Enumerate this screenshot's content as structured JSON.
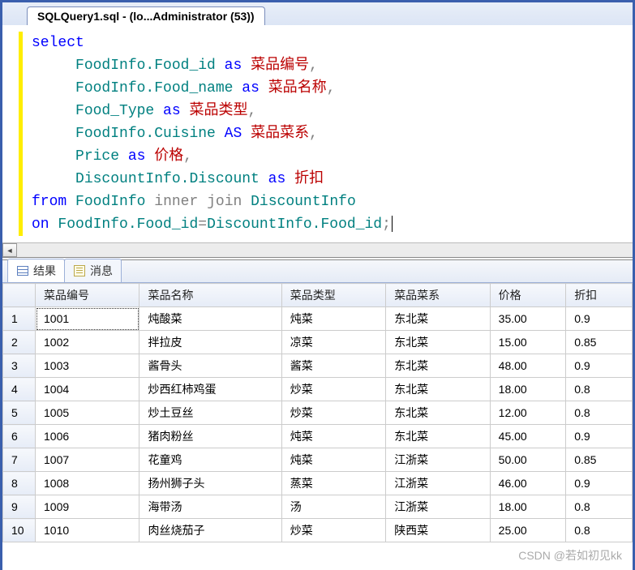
{
  "tab": {
    "title": "SQLQuery1.sql - (lo...Administrator (53))"
  },
  "sql": {
    "kw_select": "select",
    "l1_ident": "FoodInfo.Food_id",
    "l1_as": "as",
    "l1_alias": "菜品编号",
    "l2_ident": "FoodInfo.Food_name",
    "l2_as": "as",
    "l2_alias": "菜品名称",
    "l3_ident": "Food_Type",
    "l3_as": "as",
    "l3_alias": "菜品类型",
    "l4_ident": "FoodInfo.Cuisine",
    "l4_as": "AS",
    "l4_alias": "菜品菜系",
    "l5_ident": "Price",
    "l5_as": "as",
    "l5_alias": "价格",
    "l6_ident": "DiscountInfo.Discount",
    "l6_as": "as",
    "l6_alias": "折扣",
    "kw_from": "from",
    "from_t1": "FoodInfo",
    "kw_inner": "inner",
    "kw_join": "join",
    "from_t2": "DiscountInfo",
    "kw_on": "on",
    "on_lhs": "FoodInfo.Food_id",
    "on_rhs": "DiscountInfo.Food_id",
    "comma": ",",
    "semicolon": ";",
    "eq": "="
  },
  "results_tabs": {
    "results": "结果",
    "messages": "消息"
  },
  "grid": {
    "columns": [
      "菜品编号",
      "菜品名称",
      "菜品类型",
      "菜品菜系",
      "价格",
      "折扣"
    ],
    "rows": [
      {
        "n": "1",
        "c": [
          "1001",
          "炖酸菜",
          "炖菜",
          "东北菜",
          "35.00",
          "0.9"
        ]
      },
      {
        "n": "2",
        "c": [
          "1002",
          "拌拉皮",
          "凉菜",
          "东北菜",
          "15.00",
          "0.85"
        ]
      },
      {
        "n": "3",
        "c": [
          "1003",
          "酱骨头",
          "酱菜",
          "东北菜",
          "48.00",
          "0.9"
        ]
      },
      {
        "n": "4",
        "c": [
          "1004",
          "炒西红柿鸡蛋",
          "炒菜",
          "东北菜",
          "18.00",
          "0.8"
        ]
      },
      {
        "n": "5",
        "c": [
          "1005",
          "炒土豆丝",
          "炒菜",
          "东北菜",
          "12.00",
          "0.8"
        ]
      },
      {
        "n": "6",
        "c": [
          "1006",
          "猪肉粉丝",
          "炖菜",
          "东北菜",
          "45.00",
          "0.9"
        ]
      },
      {
        "n": "7",
        "c": [
          "1007",
          "花童鸡",
          "炖菜",
          "江浙菜",
          "50.00",
          "0.85"
        ]
      },
      {
        "n": "8",
        "c": [
          "1008",
          "扬州狮子头",
          "蒸菜",
          "江浙菜",
          "46.00",
          "0.9"
        ]
      },
      {
        "n": "9",
        "c": [
          "1009",
          "海带汤",
          "汤",
          "江浙菜",
          "18.00",
          "0.8"
        ]
      },
      {
        "n": "10",
        "c": [
          "1010",
          "肉丝烧茄子",
          "炒菜",
          "陕西菜",
          "25.00",
          "0.8"
        ]
      }
    ]
  },
  "watermark": "CSDN @若如初见kk"
}
